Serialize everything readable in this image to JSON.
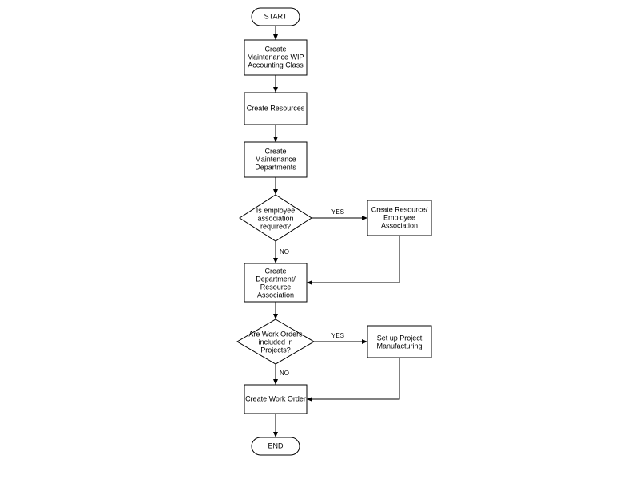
{
  "chart_data": {
    "type": "flowchart",
    "title": "",
    "nodes": [
      {
        "id": "start",
        "type": "terminator",
        "label": "START"
      },
      {
        "id": "n1",
        "type": "process",
        "label": "Create Maintenance WIP Accounting Class"
      },
      {
        "id": "n2",
        "type": "process",
        "label": "Create Resources"
      },
      {
        "id": "n3",
        "type": "process",
        "label": "Create Maintenance Departments"
      },
      {
        "id": "d1",
        "type": "decision",
        "label": "Is employee association required?"
      },
      {
        "id": "n4",
        "type": "process",
        "label": "Create Resource/ Employee Association"
      },
      {
        "id": "n5",
        "type": "process",
        "label": "Create Department/ Resource Association"
      },
      {
        "id": "d2",
        "type": "decision",
        "label": "Are Work Orders included in Projects?"
      },
      {
        "id": "n6",
        "type": "process",
        "label": "Set up Project Manufacturing"
      },
      {
        "id": "n7",
        "type": "process",
        "label": "Create Work Order"
      },
      {
        "id": "end",
        "type": "terminator",
        "label": "END"
      }
    ],
    "edges": [
      {
        "from": "start",
        "to": "n1"
      },
      {
        "from": "n1",
        "to": "n2"
      },
      {
        "from": "n2",
        "to": "n3"
      },
      {
        "from": "n3",
        "to": "d1"
      },
      {
        "from": "d1",
        "to": "n4",
        "label": "YES"
      },
      {
        "from": "d1",
        "to": "n5",
        "label": "NO"
      },
      {
        "from": "n4",
        "to": "n5"
      },
      {
        "from": "n5",
        "to": "d2"
      },
      {
        "from": "d2",
        "to": "n6",
        "label": "YES"
      },
      {
        "from": "d2",
        "to": "n7",
        "label": "NO"
      },
      {
        "from": "n6",
        "to": "n7"
      },
      {
        "from": "n7",
        "to": "end"
      }
    ]
  },
  "labels": {
    "start": "START",
    "end": "END",
    "n1a": "Create",
    "n1b": "Maintenance WIP",
    "n1c": "Accounting Class",
    "n2": "Create Resources",
    "n3a": "Create",
    "n3b": "Maintenance",
    "n3c": "Departments",
    "d1a": "Is employee",
    "d1b": "association",
    "d1c": "required?",
    "n4a": "Create Resource/",
    "n4b": "Employee",
    "n4c": "Association",
    "n5a": "Create",
    "n5b": "Department/",
    "n5c": "Resource",
    "n5d": "Association",
    "d2a": "Are Work Orders",
    "d2b": "included in",
    "d2c": "Projects?",
    "n6a": "Set up Project",
    "n6b": "Manufacturing",
    "n7": "Create Work Order",
    "yes": "YES",
    "no": "NO"
  }
}
